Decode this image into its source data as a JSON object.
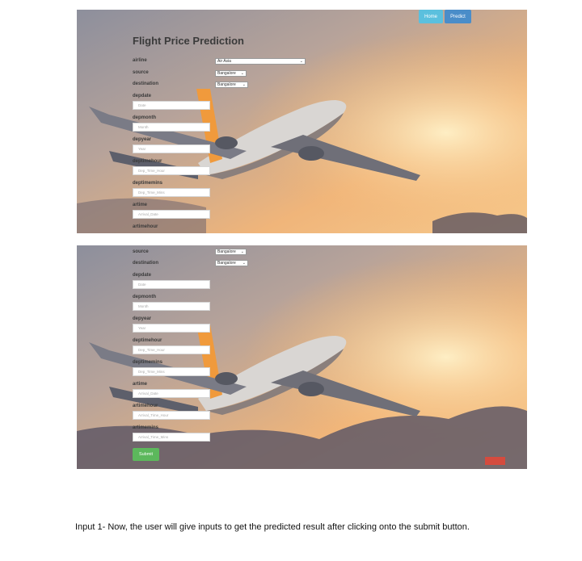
{
  "shot1": {
    "nav": {
      "home": "Home",
      "predict": "Predict"
    },
    "title": "Flight Price Prediction",
    "airline_label": "airline",
    "airline_value": "Air Asia",
    "source_label": "source",
    "source_value": "Bangalore",
    "destination_label": "destination",
    "destination_value": "Bangalore",
    "depdate_label": "depdate",
    "depdate_ph": "Date",
    "depmonth_label": "depmonth",
    "depmonth_ph": "Month",
    "depyear_label": "depyear",
    "depyear_ph": "Year",
    "deptimehour_label": "deptimehour",
    "deptimehour_ph": "Dep_Time_Hour",
    "deptimemins_label": "deptimemins",
    "deptimemins_ph": "Dep_Time_Mins",
    "artime_label": "artime",
    "artime_ph": "Arrival_Date",
    "artimehour_label": "artimehour"
  },
  "shot2": {
    "source_label": "source",
    "source_value": "Bangalore",
    "destination_label": "destination",
    "destination_value": "Bangalore",
    "depdate_label": "depdate",
    "depdate_ph": "Date",
    "depmonth_label": "depmonth",
    "depmonth_ph": "Month",
    "depyear_label": "depyear",
    "depyear_ph": "Year",
    "deptimehour_label": "deptimehour",
    "deptimehour_ph": "Dep_Time_Hour",
    "deptimemins_label": "deptimemins",
    "deptimemins_ph": "Dep_Time_Mins",
    "artime_label": "artime",
    "artime_ph": "Arrival_Date",
    "artimehour_label": "artimehour",
    "artimehour_ph": "Arrival_Time_Hour",
    "artimemins_label": "artimemins",
    "artimemins_ph": "Arrival_Time_Mins",
    "submit": "Submit"
  },
  "caption": "Input 1- Now, the user will give inputs to get the predicted result after clicking onto the submit button.",
  "colors": {
    "home_btn": "#5bc0de",
    "predict_btn": "#4a8dc9",
    "submit_btn": "#5cb85c",
    "sky_top": "#9a9aa6",
    "sky_glow": "#f4b36a"
  }
}
